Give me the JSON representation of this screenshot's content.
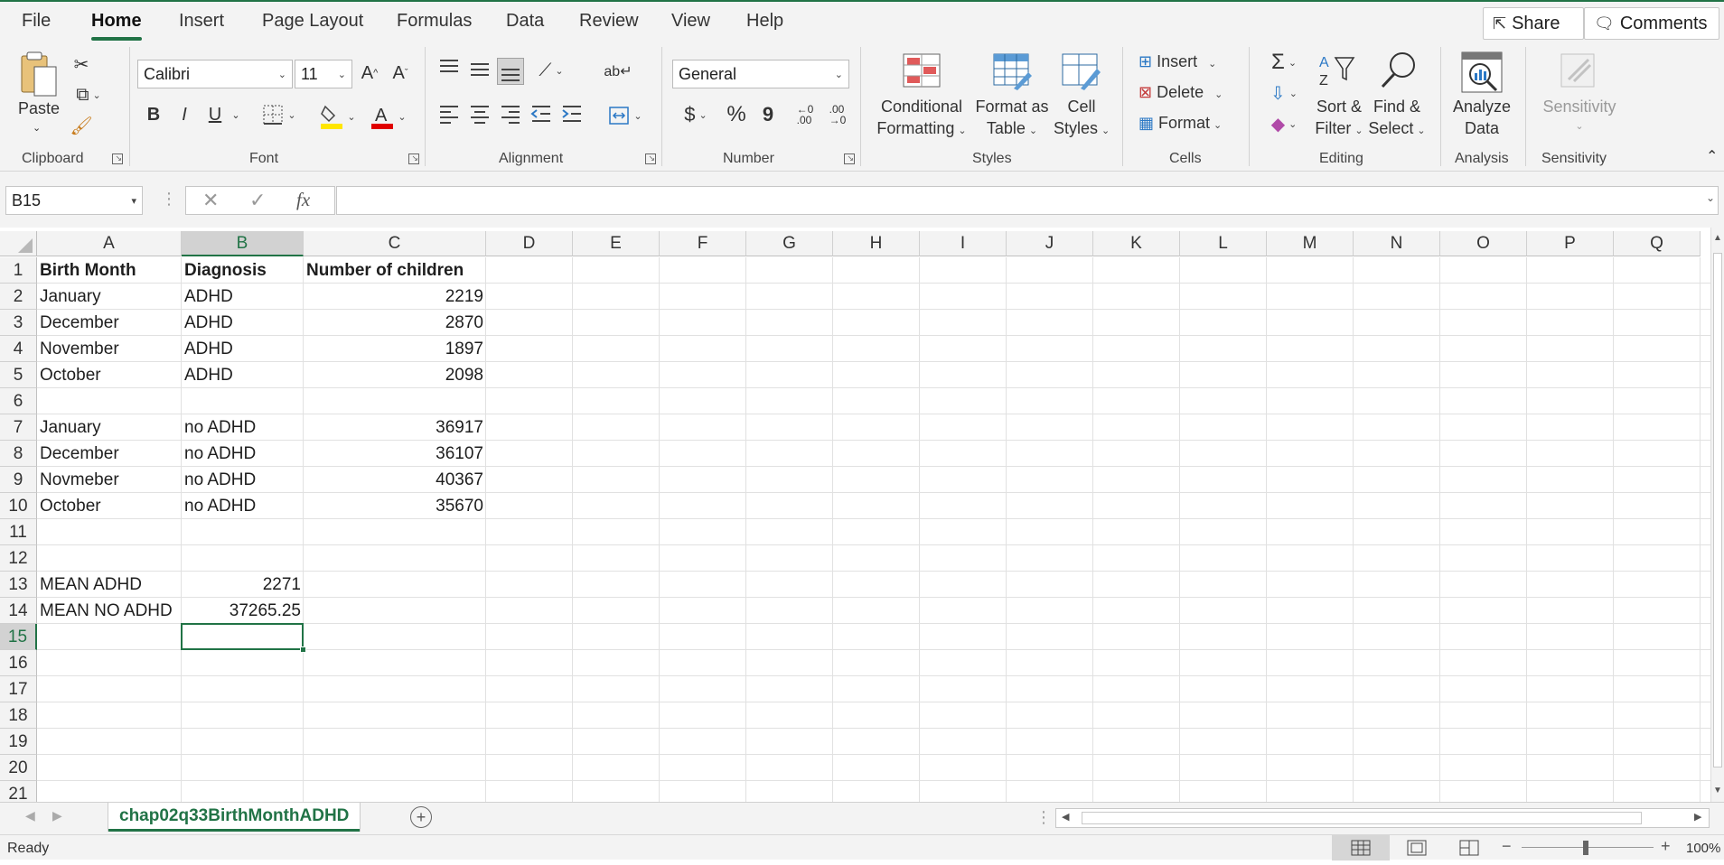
{
  "menu": {
    "tabs": [
      "File",
      "Home",
      "Insert",
      "Page Layout",
      "Formulas",
      "Data",
      "Review",
      "View",
      "Help"
    ],
    "share": "Share",
    "comments": "Comments"
  },
  "ribbon": {
    "clipboard": {
      "paste": "Paste",
      "label": "Clipboard"
    },
    "font": {
      "name": "Calibri",
      "size": "11",
      "bold": "B",
      "italic": "I",
      "underline": "U",
      "label": "Font"
    },
    "alignment": {
      "label": "Alignment"
    },
    "number": {
      "format": "General",
      "currency": "$",
      "percent": "%",
      "comma": "9",
      "label": "Number"
    },
    "styles": {
      "conditional_1": "Conditional",
      "conditional_2": "Formatting",
      "format_table_1": "Format as",
      "format_table_2": "Table",
      "cell_styles_1": "Cell",
      "cell_styles_2": "Styles",
      "label": "Styles"
    },
    "cells": {
      "insert": "Insert",
      "delete": "Delete",
      "format": "Format",
      "label": "Cells"
    },
    "editing": {
      "sort_1": "Sort &",
      "sort_2": "Filter",
      "find_1": "Find &",
      "find_2": "Select",
      "label": "Editing"
    },
    "analysis": {
      "analyze_1": "Analyze",
      "analyze_2": "Data",
      "label": "Analysis"
    },
    "sensitivity": {
      "button": "Sensitivity",
      "label": "Sensitivity"
    }
  },
  "formula_bar": {
    "name_box": "B15",
    "fx": "fx",
    "content": ""
  },
  "grid": {
    "columns": [
      "A",
      "B",
      "C",
      "D",
      "E",
      "F",
      "G",
      "H",
      "I",
      "J",
      "K",
      "L",
      "M",
      "N",
      "O",
      "P",
      "Q"
    ],
    "rows": [
      "1",
      "2",
      "3",
      "4",
      "5",
      "6",
      "7",
      "8",
      "9",
      "10",
      "11",
      "12",
      "13",
      "14",
      "15",
      "16",
      "17",
      "18",
      "19",
      "20",
      "21"
    ],
    "cells": {
      "A1": "Birth Month",
      "B1": "Diagnosis",
      "C1": "Number of children",
      "A2": "January",
      "B2": "ADHD",
      "C2": "2219",
      "A3": "December",
      "B3": "ADHD",
      "C3": "2870",
      "A4": "November",
      "B4": "ADHD",
      "C4": "1897",
      "A5": "October",
      "B5": "ADHD",
      "C5": "2098",
      "A7": "January",
      "B7": "no ADHD",
      "C7": "36917",
      "A8": "December",
      "B8": "no ADHD",
      "C8": "36107",
      "A9": "Novmeber",
      "B9": "no ADHD",
      "C9": "40367",
      "A10": "October",
      "B10": "no ADHD",
      "C10": "35670",
      "A13": "MEAN ADHD",
      "B13": "2271",
      "A14": "MEAN NO ADHD",
      "B14": "37265.25"
    }
  },
  "sheet_tab": "chap02q33BirthMonthADHD",
  "status": {
    "ready": "Ready",
    "zoom": "100%"
  },
  "colors": {
    "accent": "#217346",
    "highlight": "#FFE600",
    "font_color": "#E00000"
  }
}
